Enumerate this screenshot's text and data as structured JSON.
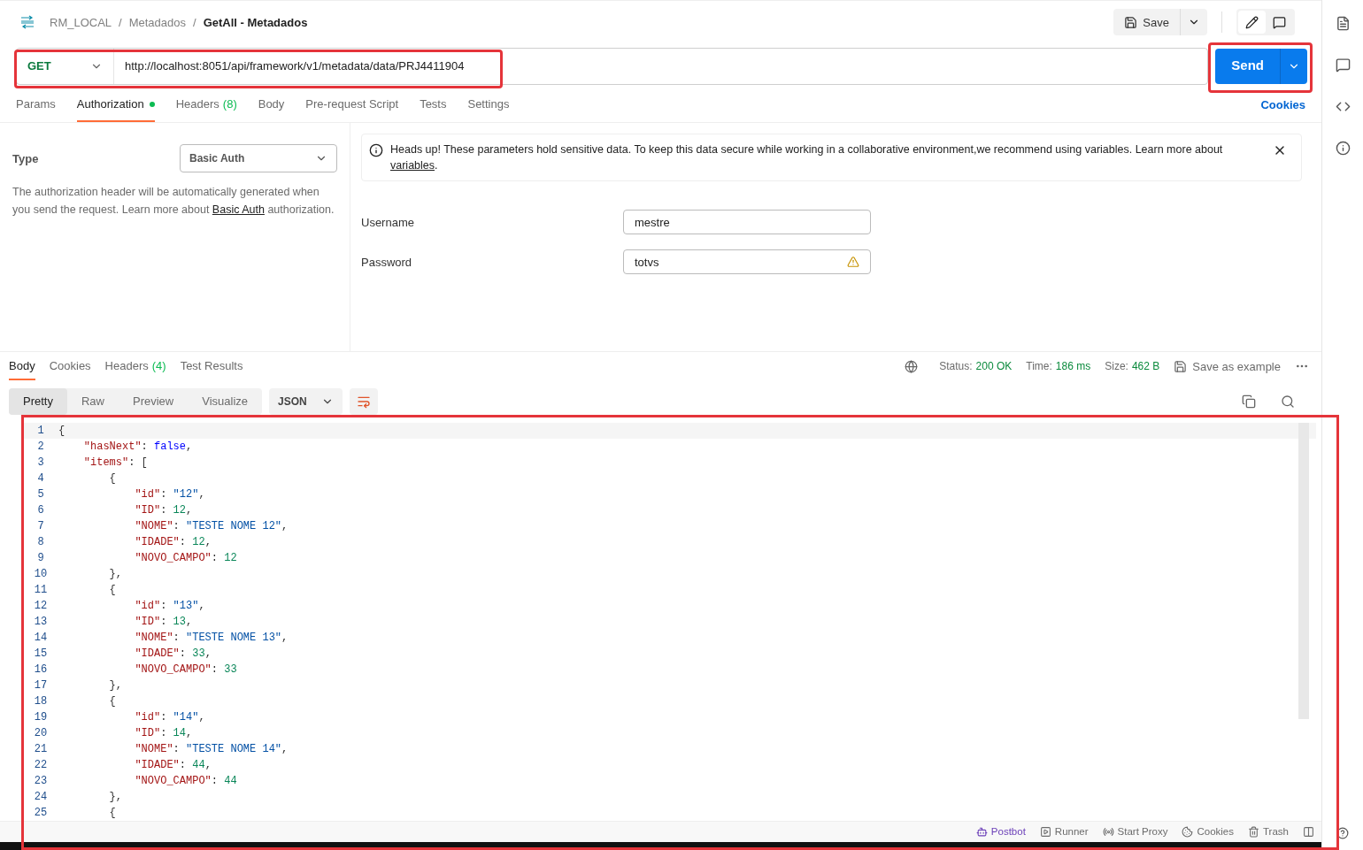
{
  "breadcrumb": {
    "items": [
      {
        "label": "RM_LOCAL",
        "separator": "/"
      },
      {
        "label": "Metadados",
        "separator": "/"
      }
    ],
    "current": "GetAll - Metadados"
  },
  "header": {
    "save": "Save"
  },
  "request": {
    "method": "GET",
    "url": "http://localhost:8051/api/framework/v1/metadata/data/PRJ4411904",
    "send": "Send"
  },
  "request_tabs": [
    {
      "label": "Params",
      "selected": false
    },
    {
      "label": "Authorization",
      "selected": true,
      "dot": true
    },
    {
      "label": "Headers",
      "count": "(8)",
      "selected": false
    },
    {
      "label": "Body",
      "selected": false
    },
    {
      "label": "Pre-request Script",
      "selected": false
    },
    {
      "label": "Tests",
      "selected": false
    },
    {
      "label": "Settings",
      "selected": false
    }
  ],
  "cookies_link": "Cookies",
  "auth": {
    "type_label": "Type",
    "type_value": "Basic Auth",
    "description": "The authorization header will be automatically generated when you send the request. Learn more about ",
    "description_link": "Basic Auth",
    "description_end": " authorization.",
    "notice": "Heads up! These parameters hold sensitive data. To keep this data secure while working in a collaborative environment,we recommend using variables. Learn more about ",
    "notice_link": "variables",
    "notice_end": ".",
    "fields": [
      {
        "label": "Username",
        "value": "mestre",
        "warning": false
      },
      {
        "label": "Password",
        "value": "totvs",
        "warning": true
      }
    ]
  },
  "response_tabs": [
    {
      "label": "Body",
      "selected": true
    },
    {
      "label": "Cookies",
      "selected": false
    },
    {
      "label": "Headers",
      "count": "(4)",
      "selected": false
    },
    {
      "label": "Test Results",
      "selected": false
    }
  ],
  "response_meta": [
    {
      "label": "Status:",
      "value": "200 OK"
    },
    {
      "label": "Time:",
      "value": "186 ms"
    },
    {
      "label": "Size:",
      "value": "462 B"
    }
  ],
  "save_example": "Save as example",
  "view_modes": [
    {
      "label": "Pretty",
      "selected": true
    },
    {
      "label": "Raw",
      "selected": false
    },
    {
      "label": "Preview",
      "selected": false
    },
    {
      "label": "Visualize",
      "selected": false
    }
  ],
  "format": "JSON",
  "code_lines": [
    {
      "number": "1",
      "tokens": [
        {
          "kind": "punct",
          "text": "{"
        }
      ]
    },
    {
      "number": "2",
      "tokens": [
        {
          "kind": "indent"
        },
        {
          "kind": "key",
          "text": "\"hasNext\""
        },
        {
          "kind": "punct",
          "text": ": "
        },
        {
          "kind": "bool",
          "text": "false"
        },
        {
          "kind": "punct",
          "text": ","
        }
      ]
    },
    {
      "number": "3",
      "tokens": [
        {
          "kind": "indent"
        },
        {
          "kind": "key",
          "text": "\"items\""
        },
        {
          "kind": "punct",
          "text": ": ["
        }
      ]
    },
    {
      "number": "4",
      "tokens": [
        {
          "kind": "indent"
        },
        {
          "kind": "indent"
        },
        {
          "kind": "punct",
          "text": "{"
        }
      ]
    },
    {
      "number": "5",
      "tokens": [
        {
          "kind": "indent"
        },
        {
          "kind": "indent"
        },
        {
          "kind": "indent"
        },
        {
          "kind": "key",
          "text": "\"id\""
        },
        {
          "kind": "punct",
          "text": ": "
        },
        {
          "kind": "string",
          "text": "\"12\""
        },
        {
          "kind": "punct",
          "text": ","
        }
      ]
    },
    {
      "number": "6",
      "tokens": [
        {
          "kind": "indent"
        },
        {
          "kind": "indent"
        },
        {
          "kind": "indent"
        },
        {
          "kind": "key",
          "text": "\"ID\""
        },
        {
          "kind": "punct",
          "text": ": "
        },
        {
          "kind": "number",
          "text": "12"
        },
        {
          "kind": "punct",
          "text": ","
        }
      ]
    },
    {
      "number": "7",
      "tokens": [
        {
          "kind": "indent"
        },
        {
          "kind": "indent"
        },
        {
          "kind": "indent"
        },
        {
          "kind": "key",
          "text": "\"NOME\""
        },
        {
          "kind": "punct",
          "text": ": "
        },
        {
          "kind": "string",
          "text": "\"TESTE NOME 12\""
        },
        {
          "kind": "punct",
          "text": ","
        }
      ]
    },
    {
      "number": "8",
      "tokens": [
        {
          "kind": "indent"
        },
        {
          "kind": "indent"
        },
        {
          "kind": "indent"
        },
        {
          "kind": "key",
          "text": "\"IDADE\""
        },
        {
          "kind": "punct",
          "text": ": "
        },
        {
          "kind": "number",
          "text": "12"
        },
        {
          "kind": "punct",
          "text": ","
        }
      ]
    },
    {
      "number": "9",
      "tokens": [
        {
          "kind": "indent"
        },
        {
          "kind": "indent"
        },
        {
          "kind": "indent"
        },
        {
          "kind": "key",
          "text": "\"NOVO_CAMPO\""
        },
        {
          "kind": "punct",
          "text": ": "
        },
        {
          "kind": "number",
          "text": "12"
        }
      ]
    },
    {
      "number": "10",
      "tokens": [
        {
          "kind": "indent"
        },
        {
          "kind": "indent"
        },
        {
          "kind": "punct",
          "text": "},"
        }
      ]
    },
    {
      "number": "11",
      "tokens": [
        {
          "kind": "indent"
        },
        {
          "kind": "indent"
        },
        {
          "kind": "punct",
          "text": "{"
        }
      ]
    },
    {
      "number": "12",
      "tokens": [
        {
          "kind": "indent"
        },
        {
          "kind": "indent"
        },
        {
          "kind": "indent"
        },
        {
          "kind": "key",
          "text": "\"id\""
        },
        {
          "kind": "punct",
          "text": ": "
        },
        {
          "kind": "string",
          "text": "\"13\""
        },
        {
          "kind": "punct",
          "text": ","
        }
      ]
    },
    {
      "number": "13",
      "tokens": [
        {
          "kind": "indent"
        },
        {
          "kind": "indent"
        },
        {
          "kind": "indent"
        },
        {
          "kind": "key",
          "text": "\"ID\""
        },
        {
          "kind": "punct",
          "text": ": "
        },
        {
          "kind": "number",
          "text": "13"
        },
        {
          "kind": "punct",
          "text": ","
        }
      ]
    },
    {
      "number": "14",
      "tokens": [
        {
          "kind": "indent"
        },
        {
          "kind": "indent"
        },
        {
          "kind": "indent"
        },
        {
          "kind": "key",
          "text": "\"NOME\""
        },
        {
          "kind": "punct",
          "text": ": "
        },
        {
          "kind": "string",
          "text": "\"TESTE NOME 13\""
        },
        {
          "kind": "punct",
          "text": ","
        }
      ]
    },
    {
      "number": "15",
      "tokens": [
        {
          "kind": "indent"
        },
        {
          "kind": "indent"
        },
        {
          "kind": "indent"
        },
        {
          "kind": "key",
          "text": "\"IDADE\""
        },
        {
          "kind": "punct",
          "text": ": "
        },
        {
          "kind": "number",
          "text": "33"
        },
        {
          "kind": "punct",
          "text": ","
        }
      ]
    },
    {
      "number": "16",
      "tokens": [
        {
          "kind": "indent"
        },
        {
          "kind": "indent"
        },
        {
          "kind": "indent"
        },
        {
          "kind": "key",
          "text": "\"NOVO_CAMPO\""
        },
        {
          "kind": "punct",
          "text": ": "
        },
        {
          "kind": "number",
          "text": "33"
        }
      ]
    },
    {
      "number": "17",
      "tokens": [
        {
          "kind": "indent"
        },
        {
          "kind": "indent"
        },
        {
          "kind": "punct",
          "text": "},"
        }
      ]
    },
    {
      "number": "18",
      "tokens": [
        {
          "kind": "indent"
        },
        {
          "kind": "indent"
        },
        {
          "kind": "punct",
          "text": "{"
        }
      ]
    },
    {
      "number": "19",
      "tokens": [
        {
          "kind": "indent"
        },
        {
          "kind": "indent"
        },
        {
          "kind": "indent"
        },
        {
          "kind": "key",
          "text": "\"id\""
        },
        {
          "kind": "punct",
          "text": ": "
        },
        {
          "kind": "string",
          "text": "\"14\""
        },
        {
          "kind": "punct",
          "text": ","
        }
      ]
    },
    {
      "number": "20",
      "tokens": [
        {
          "kind": "indent"
        },
        {
          "kind": "indent"
        },
        {
          "kind": "indent"
        },
        {
          "kind": "key",
          "text": "\"ID\""
        },
        {
          "kind": "punct",
          "text": ": "
        },
        {
          "kind": "number",
          "text": "14"
        },
        {
          "kind": "punct",
          "text": ","
        }
      ]
    },
    {
      "number": "21",
      "tokens": [
        {
          "kind": "indent"
        },
        {
          "kind": "indent"
        },
        {
          "kind": "indent"
        },
        {
          "kind": "key",
          "text": "\"NOME\""
        },
        {
          "kind": "punct",
          "text": ": "
        },
        {
          "kind": "string",
          "text": "\"TESTE NOME 14\""
        },
        {
          "kind": "punct",
          "text": ","
        }
      ]
    },
    {
      "number": "22",
      "tokens": [
        {
          "kind": "indent"
        },
        {
          "kind": "indent"
        },
        {
          "kind": "indent"
        },
        {
          "kind": "key",
          "text": "\"IDADE\""
        },
        {
          "kind": "punct",
          "text": ": "
        },
        {
          "kind": "number",
          "text": "44"
        },
        {
          "kind": "punct",
          "text": ","
        }
      ]
    },
    {
      "number": "23",
      "tokens": [
        {
          "kind": "indent"
        },
        {
          "kind": "indent"
        },
        {
          "kind": "indent"
        },
        {
          "kind": "key",
          "text": "\"NOVO_CAMPO\""
        },
        {
          "kind": "punct",
          "text": ": "
        },
        {
          "kind": "number",
          "text": "44"
        }
      ]
    },
    {
      "number": "24",
      "tokens": [
        {
          "kind": "indent"
        },
        {
          "kind": "indent"
        },
        {
          "kind": "punct",
          "text": "},"
        }
      ]
    },
    {
      "number": "25",
      "tokens": [
        {
          "kind": "indent"
        },
        {
          "kind": "indent"
        },
        {
          "kind": "punct",
          "text": "{"
        }
      ]
    }
  ],
  "footer": [
    {
      "kind": "postbot",
      "label": "Postbot"
    },
    {
      "kind": "runner",
      "label": "Runner"
    },
    {
      "kind": "proxy",
      "label": "Start Proxy"
    },
    {
      "kind": "cookies",
      "label": "Cookies"
    },
    {
      "kind": "trash",
      "label": "Trash"
    }
  ]
}
